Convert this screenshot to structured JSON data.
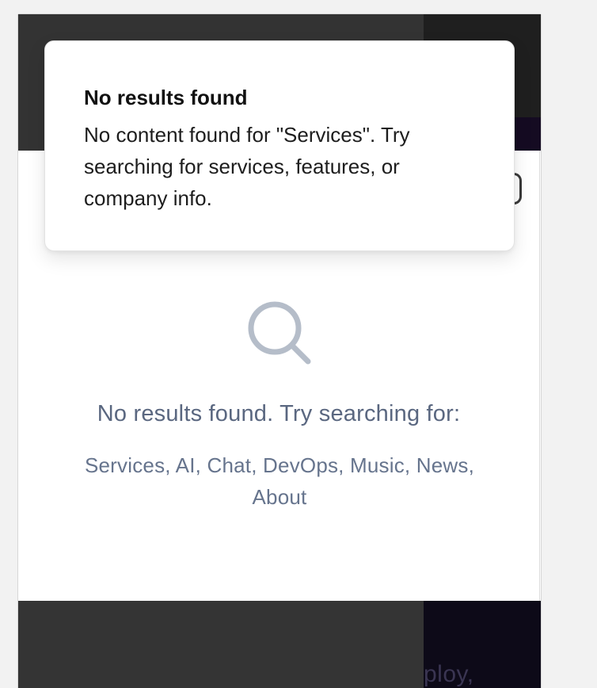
{
  "toast": {
    "title": "No results found",
    "message": "No content found for \"Services\". Try searching for services, features, or company info."
  },
  "search_results": {
    "empty_message": "No results found. Try searching for:",
    "suggestions": "Services, AI, Chat, DevOps, Music, News, About",
    "icon": "search-icon"
  },
  "background": {
    "bottom_text": "ploy,"
  },
  "colors": {
    "toast_bg": "#ffffff",
    "empty_text": "#5a6780",
    "icon": "#b5bdc9"
  }
}
